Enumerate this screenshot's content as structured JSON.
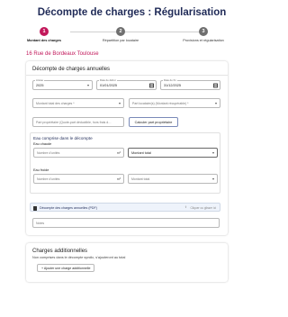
{
  "page": {
    "title": "Décompte de charges : Régularisation"
  },
  "stepper": {
    "steps": [
      {
        "number": "1",
        "label": "Montant des charges",
        "active": true
      },
      {
        "number": "2",
        "label": "Répartition par locataire",
        "active": false
      },
      {
        "number": "3",
        "label": "Provisions et régularisation",
        "active": false
      }
    ]
  },
  "property": {
    "address": "16 Rue de Bordeaux Toulouse"
  },
  "annual": {
    "title": "Décompte de charges annuelles",
    "year": {
      "label": "Année",
      "value": "2025"
    },
    "start_date": {
      "label": "Date de début",
      "value": "01/01/2025"
    },
    "end_date": {
      "label": "Date de fin",
      "value": "31/12/2025"
    },
    "total_charges": {
      "placeholder": "Montant total des charges *"
    },
    "recoverable": {
      "placeholder": "Part locataire(s) (Montant récupérable) *"
    },
    "owner_share": {
      "placeholder": "Part propriétaire (Quote-part déductible, hors frais d…"
    },
    "calc_button": "Calculer part propriétaire",
    "water": {
      "title": "Eau comprise dans le décompte",
      "hot": {
        "label": "Eau chaude",
        "units_placeholder": "Nombre d'unités",
        "unit": "m³",
        "amount_value": "Montant total"
      },
      "cold": {
        "label": "Eau froide",
        "units_placeholder": "Nombre d'unités",
        "unit": "m³",
        "amount_placeholder": "Montant total"
      }
    },
    "pdf": {
      "label": "Décompte des charges annuelles (PDF)",
      "upload_text": "Cliquer ou glisser ici"
    },
    "notes": {
      "placeholder": "Notes"
    }
  },
  "additional": {
    "title": "Charges additionnelles",
    "subtitle": "Non comprises dans le décompte syndic, s'ajouteront au total",
    "add_button": "+ Ajouter une charge additionnelle"
  },
  "colors": {
    "primary": "#1f2a57",
    "accent": "#c2185b"
  },
  "icons": {
    "calendar": "calendar-icon",
    "dropdown": "chevron-down-icon",
    "pdf": "pdf-icon",
    "upload": "upload-icon"
  }
}
